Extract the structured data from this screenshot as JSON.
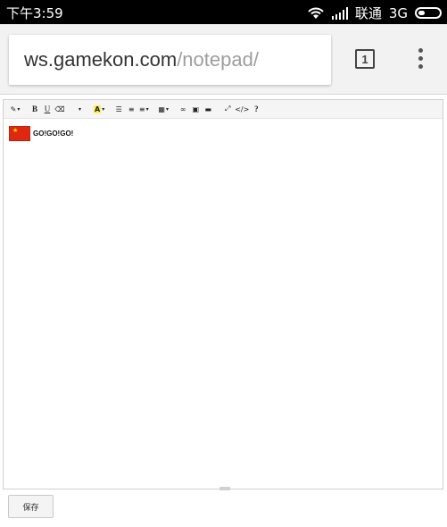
{
  "status_bar": {
    "time": "下午3:59",
    "carrier": "联通",
    "network": "3G"
  },
  "browser": {
    "url_host": "ws.gamekon.com",
    "url_path": "/notepad/",
    "tab_count": "1"
  },
  "toolbar": {
    "items": [
      {
        "name": "magic-format",
        "label": "✎"
      },
      {
        "name": "bold",
        "label": "B"
      },
      {
        "name": "underline",
        "label": "U"
      },
      {
        "name": "eraser",
        "label": "⌫"
      },
      {
        "name": "font-style",
        "label": "▾"
      },
      {
        "name": "text-color",
        "label": "A"
      },
      {
        "name": "unordered-list",
        "label": "☰"
      },
      {
        "name": "ordered-list",
        "label": "≡"
      },
      {
        "name": "align",
        "label": "≡"
      },
      {
        "name": "table",
        "label": "▦"
      },
      {
        "name": "link",
        "label": "∞"
      },
      {
        "name": "image",
        "label": "▣"
      },
      {
        "name": "video",
        "label": "▬"
      },
      {
        "name": "fullscreen",
        "label": "⤢"
      },
      {
        "name": "code-view",
        "label": "</>"
      },
      {
        "name": "help",
        "label": "?"
      }
    ]
  },
  "editor": {
    "content_text": "GO!GO!GO!"
  },
  "actions": {
    "save_label": "保存"
  }
}
